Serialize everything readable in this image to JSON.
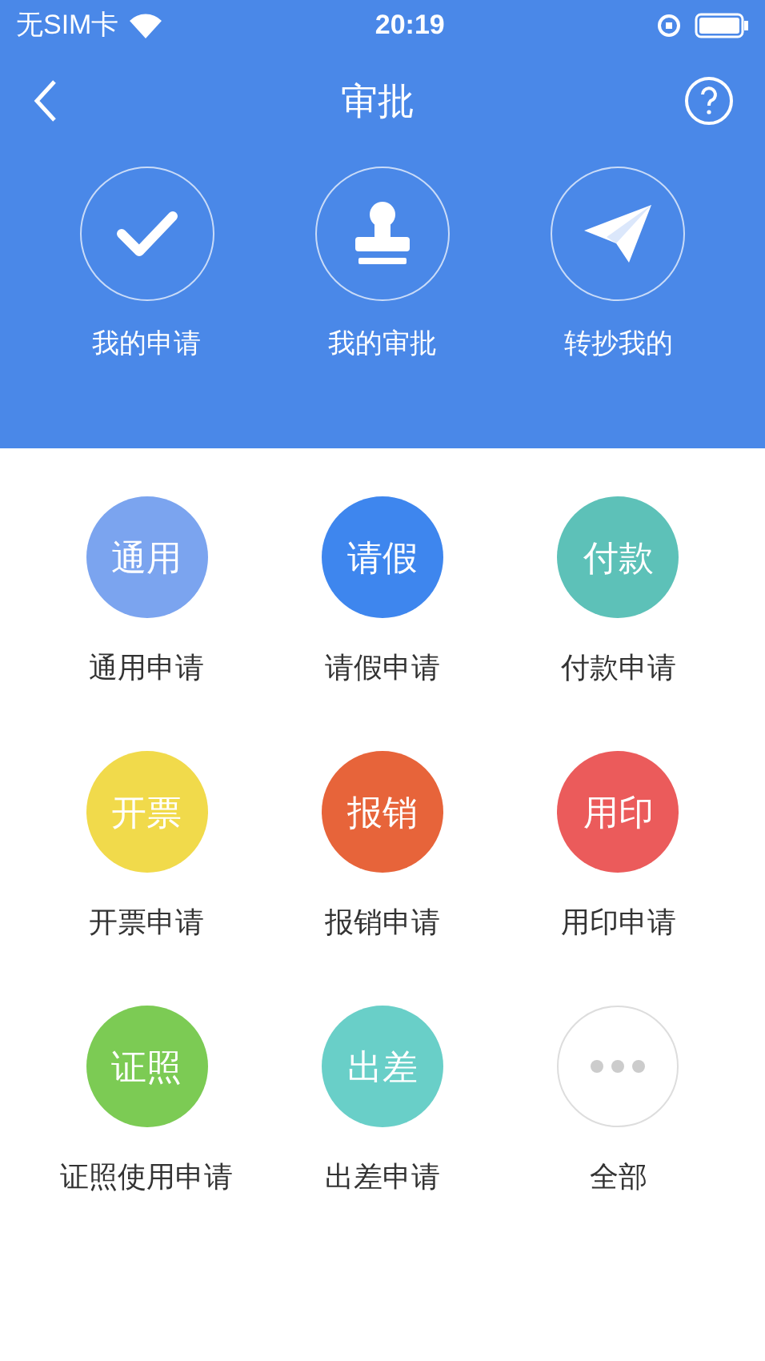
{
  "status_bar": {
    "carrier": "无SIM卡",
    "time": "20:19"
  },
  "nav": {
    "title": "审批"
  },
  "quick_actions": [
    {
      "kind": "check",
      "label": "我的申请"
    },
    {
      "kind": "stamp",
      "label": "我的审批"
    },
    {
      "kind": "plane",
      "label": "转抄我的"
    }
  ],
  "apps": [
    {
      "kind": "text",
      "icon_text": "通用",
      "label": "通用申请",
      "color": "#7ba4ef"
    },
    {
      "kind": "text",
      "icon_text": "请假",
      "label": "请假申请",
      "color": "#3e86ee"
    },
    {
      "kind": "text",
      "icon_text": "付款",
      "label": "付款申请",
      "color": "#5dc1b8"
    },
    {
      "kind": "text",
      "icon_text": "开票",
      "label": "开票申请",
      "color": "#f1da4b"
    },
    {
      "kind": "text",
      "icon_text": "报销",
      "label": "报销申请",
      "color": "#e7643a"
    },
    {
      "kind": "text",
      "icon_text": "用印",
      "label": "用印申请",
      "color": "#eb5b5b"
    },
    {
      "kind": "text",
      "icon_text": "证照",
      "label": "证照使用申请",
      "color": "#7ccb54"
    },
    {
      "kind": "text",
      "icon_text": "出差",
      "label": "出差申请",
      "color": "#69cfc8"
    },
    {
      "kind": "more",
      "label": "全部"
    }
  ]
}
